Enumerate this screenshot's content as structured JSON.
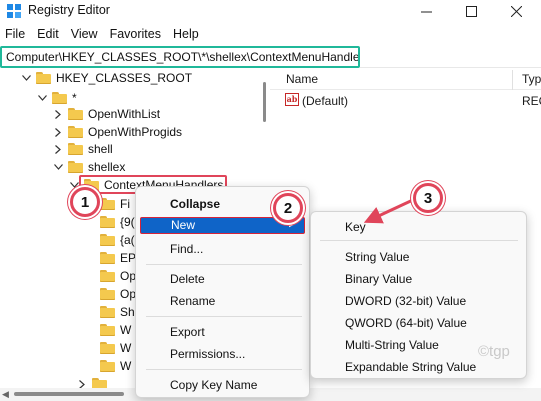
{
  "window": {
    "title": "Registry Editor"
  },
  "menubar": [
    "File",
    "Edit",
    "View",
    "Favorites",
    "Help"
  ],
  "address": {
    "value": "Computer\\HKEY_CLASSES_ROOT\\*\\shellex\\ContextMenuHandlers"
  },
  "tree": {
    "root": "HKEY_CLASSES_ROOT",
    "star": "*",
    "openwithlist": "OpenWithList",
    "openwithprogids": "OpenWithProgids",
    "shell": "shell",
    "shellex": "shellex",
    "cmh": "ContextMenuHandlers",
    "sub": [
      "Fi",
      "{9(",
      "{a(",
      "EP",
      "Op",
      "Op",
      "Sh",
      "W",
      "W",
      "W"
    ]
  },
  "list": {
    "col_name": "Name",
    "col_type": "Typ",
    "row_name": "(Default)",
    "row_type": "REC"
  },
  "context_menu": {
    "collapse": "Collapse",
    "new": "New",
    "find": "Find...",
    "delete": "Delete",
    "rename": "Rename",
    "export": "Export",
    "permissions": "Permissions...",
    "copy_key_name": "Copy Key Name"
  },
  "submenu": {
    "key": "Key",
    "string": "String Value",
    "binary": "Binary Value",
    "dword": "DWORD (32-bit) Value",
    "qword": "QWORD (64-bit) Value",
    "multi": "Multi-String Value",
    "expandable": "Expandable String Value"
  },
  "annotations": {
    "step1": "1",
    "step2": "2",
    "step3": "3"
  },
  "watermark": "©tgp",
  "colors": {
    "highlight": "#0f64c8",
    "annotation": "#e0455a",
    "address_border": "#20b89a",
    "folder": "#f4c94e"
  },
  "icons": {
    "app": "registry-editor-icon",
    "folder": "folder-icon",
    "value": "string-value-ab-icon"
  }
}
